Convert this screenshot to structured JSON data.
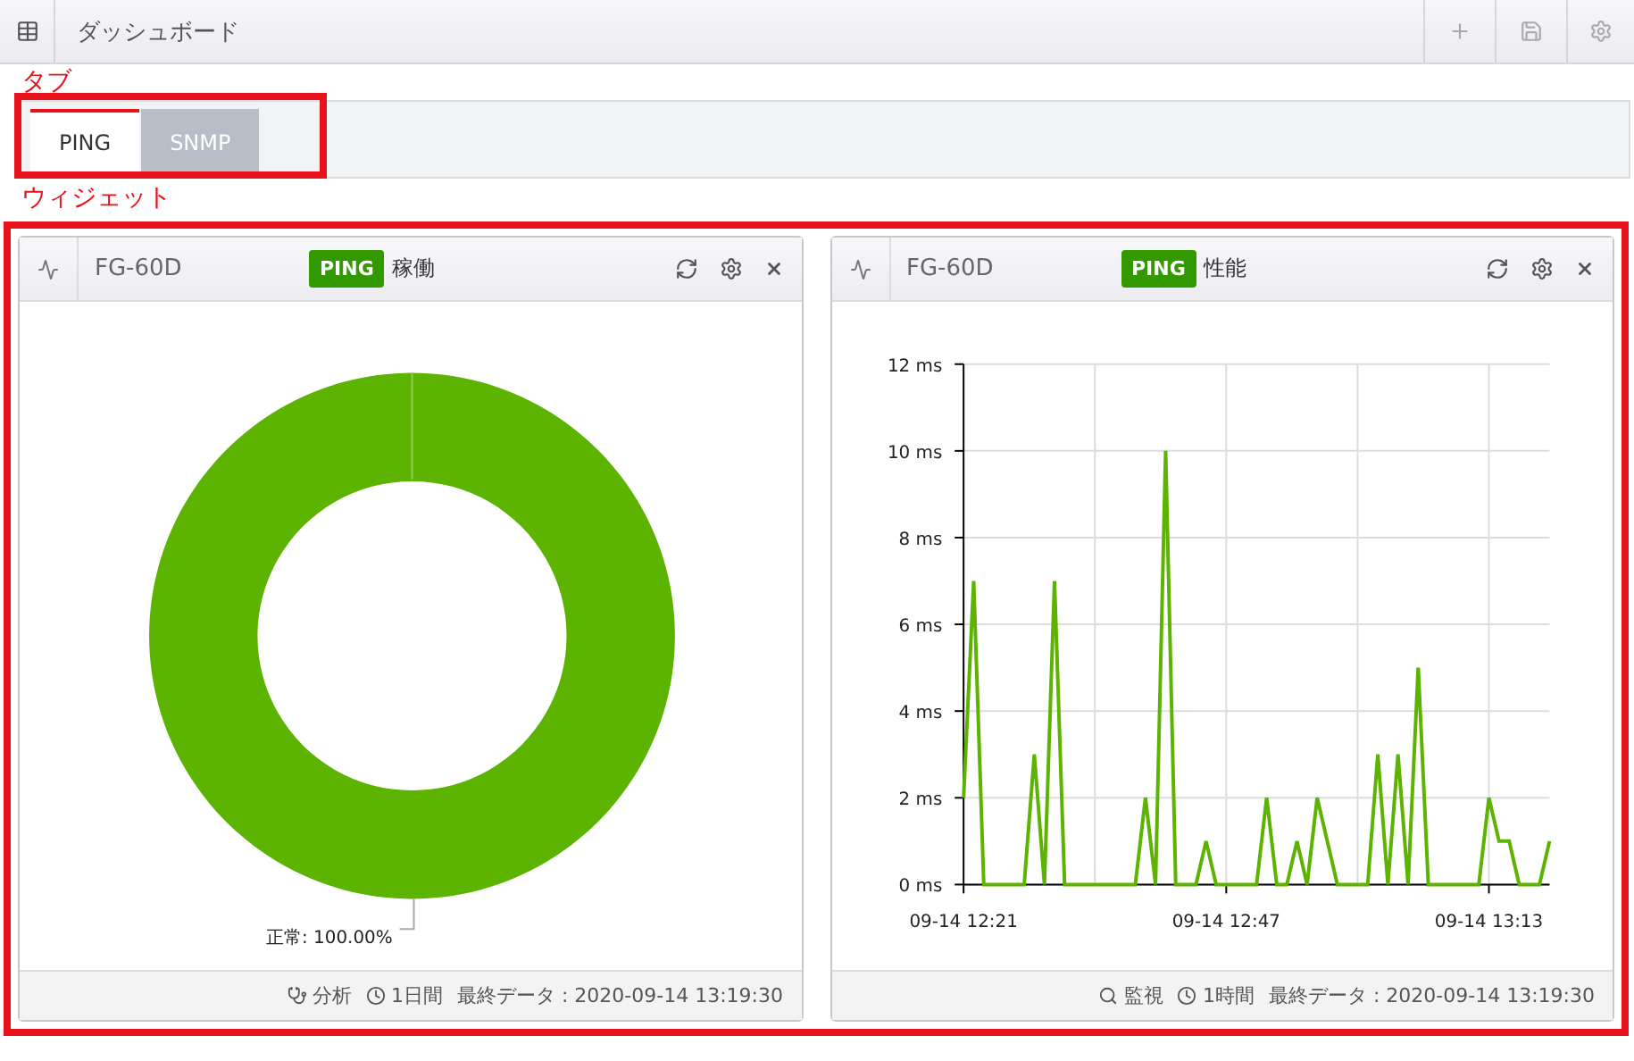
{
  "header": {
    "title": "ダッシュボード"
  },
  "annotations": [
    {
      "text": "タブ"
    },
    {
      "text": "ウィジェット"
    }
  ],
  "tabs": [
    {
      "label": "PING",
      "selected": true
    },
    {
      "label": "SNMP",
      "selected": false
    }
  ],
  "widgets": [
    {
      "device": "FG-60D",
      "badge": "PING",
      "title": "稼働",
      "kind": "donut",
      "slice_label": "正常: 100.00%",
      "footer": [
        {
          "kind": "analyze",
          "text": "分析"
        },
        {
          "kind": "period",
          "text": "1日間"
        },
        {
          "kind": "plain",
          "text": "最終データ : 2020-09-14 13:19:30"
        }
      ]
    },
    {
      "device": "FG-60D",
      "badge": "PING",
      "title": "性能",
      "kind": "line",
      "chart_data": {
        "type": "line",
        "categories": [
          "09-14 12:21",
          null,
          null,
          null,
          null,
          null,
          null,
          null,
          null,
          null,
          null,
          null,
          null,
          null,
          null,
          null,
          null,
          null,
          null,
          null,
          null,
          null,
          null,
          null,
          null,
          null,
          "09-14 12:47",
          null,
          null,
          null,
          null,
          null,
          null,
          null,
          null,
          null,
          null,
          null,
          null,
          null,
          null,
          null,
          null,
          null,
          null,
          null,
          null,
          null,
          null,
          null,
          null,
          null,
          "09-14 13:13",
          null,
          null,
          null,
          null,
          null,
          null
        ],
        "series": [
          {
            "color": "#5cb300",
            "values": [
              2,
              7,
              0,
              0,
              0,
              0,
              0,
              3,
              0,
              7,
              0,
              0,
              0,
              0,
              0,
              0,
              0,
              0,
              2,
              0,
              10,
              0,
              0,
              0,
              1,
              0,
              0,
              0,
              0,
              0,
              2,
              0,
              0,
              1,
              0,
              2,
              1,
              0,
              0,
              0,
              0,
              3,
              0,
              3,
              0,
              5,
              0,
              0,
              0,
              0,
              0,
              0,
              2,
              1,
              1,
              0,
              0,
              0,
              1
            ]
          }
        ],
        "ylim": [
          0,
          12
        ],
        "grid": true,
        "yticks": [
          {
            "value": 0,
            "label": "0 ms"
          },
          {
            "value": 2,
            "label": "2 ms"
          },
          {
            "value": 4,
            "label": "4 ms"
          },
          {
            "value": 6,
            "label": "6 ms"
          },
          {
            "value": 8,
            "label": "8 ms"
          },
          {
            "value": 10,
            "label": "10 ms"
          },
          {
            "value": 12,
            "label": "12 ms"
          }
        ]
      },
      "footer": [
        {
          "kind": "monitor",
          "text": "監視"
        },
        {
          "kind": "period",
          "text": "1時間"
        },
        {
          "kind": "plain",
          "text": "最終データ : 2020-09-14 13:19:30"
        }
      ]
    }
  ]
}
